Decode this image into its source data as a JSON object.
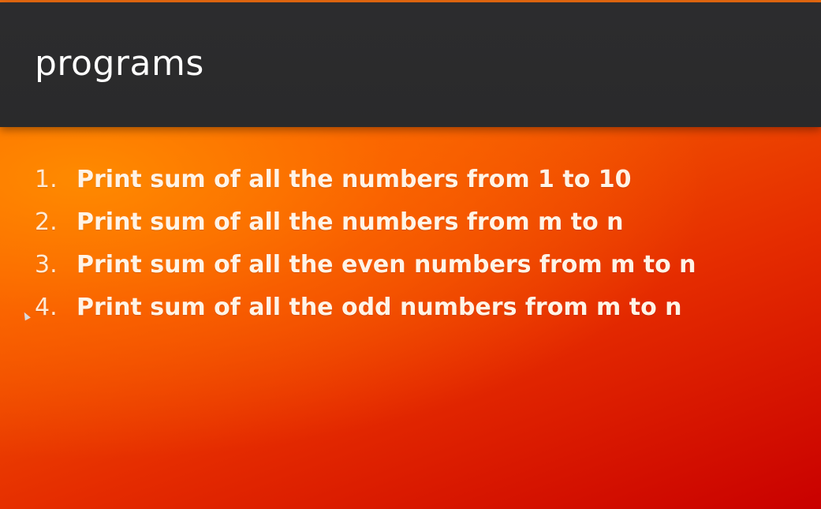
{
  "slide": {
    "title": "programs",
    "items": [
      {
        "number": "1.",
        "text": "Print sum of all the numbers from 1  to  10"
      },
      {
        "number": "2.",
        "text": "Print sum of all the numbers from m to n"
      },
      {
        "number": "3.",
        "text": "Print sum of all the even numbers from m to n"
      },
      {
        "number": "4.",
        "text": "Print sum of all the odd numbers from m to n"
      }
    ]
  },
  "colors": {
    "title_bar": "#2c2c2e",
    "background_start": "#ff7a00",
    "background_end": "#c90000",
    "text": "#ffffff"
  },
  "icons": {
    "cursor": "mouse-pointer-icon"
  }
}
